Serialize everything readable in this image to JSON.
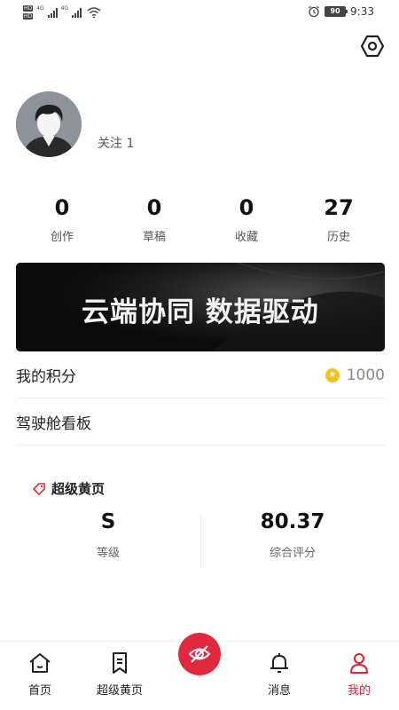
{
  "status_bar": {
    "net1": "4G",
    "net2": "4G",
    "battery": "90",
    "time": "9:33",
    "icons": [
      "hd-icon",
      "signal-icon",
      "wifi-icon",
      "alarm-icon",
      "battery-icon"
    ]
  },
  "header": {
    "settings_icon": "hexagon-settings-icon"
  },
  "profile": {
    "follow_label": "关注 1"
  },
  "stats": [
    {
      "value": "0",
      "label": "创作"
    },
    {
      "value": "0",
      "label": "草稿"
    },
    {
      "value": "0",
      "label": "收藏"
    },
    {
      "value": "27",
      "label": "历史"
    }
  ],
  "banner": {
    "text": "云端协同 数据驱动"
  },
  "menu": {
    "points_label": "我的积分",
    "points_value": "1000",
    "dashboard_label": "驾驶舱看板"
  },
  "super_yellow_pages": {
    "title": "超级黄页",
    "grade_value": "S",
    "grade_label": "等级",
    "score_value": "80.37",
    "score_label": "综合评分"
  },
  "bottom_nav": {
    "home": "首页",
    "yellow_pages": "超级黄页",
    "messages": "消息",
    "mine": "我的",
    "accent_color": "#e0293f"
  }
}
